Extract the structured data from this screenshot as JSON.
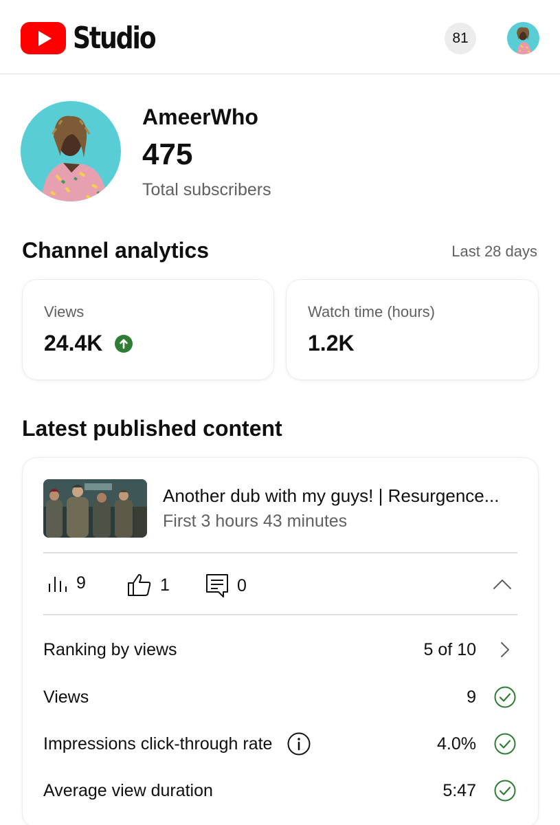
{
  "app": {
    "title": "Studio",
    "notifications_count": "81",
    "brand_color": "#ff0000"
  },
  "channel": {
    "name": "AmeerWho",
    "subscribers": "475",
    "subscribers_label": "Total subscribers"
  },
  "analytics": {
    "title": "Channel analytics",
    "period": "Last 28 days",
    "cards": [
      {
        "label": "Views",
        "value": "24.4K",
        "trend_icon": "arrow-up-circle-icon",
        "trend_color": "#2e7d32"
      },
      {
        "label": "Watch time (hours)",
        "value": "1.2K"
      }
    ]
  },
  "latest": {
    "title": "Latest published content",
    "video": {
      "title": "Another dub with my guys! | Resurgence...",
      "subtitle": "First 3 hours 43 minutes"
    },
    "stats": {
      "views": "9",
      "likes": "1",
      "comments": "0"
    },
    "metrics": [
      {
        "label": "Ranking by views",
        "value": "5 of 10",
        "icon": "chevron-right-icon"
      },
      {
        "label": "Views",
        "value": "9",
        "icon": "check-circle-icon"
      },
      {
        "label": "Impressions click-through rate",
        "value": "4.0%",
        "icon": "check-circle-icon",
        "info_icon": "info-icon"
      },
      {
        "label": "Average view duration",
        "value": "5:47",
        "icon": "check-circle-icon"
      }
    ]
  }
}
